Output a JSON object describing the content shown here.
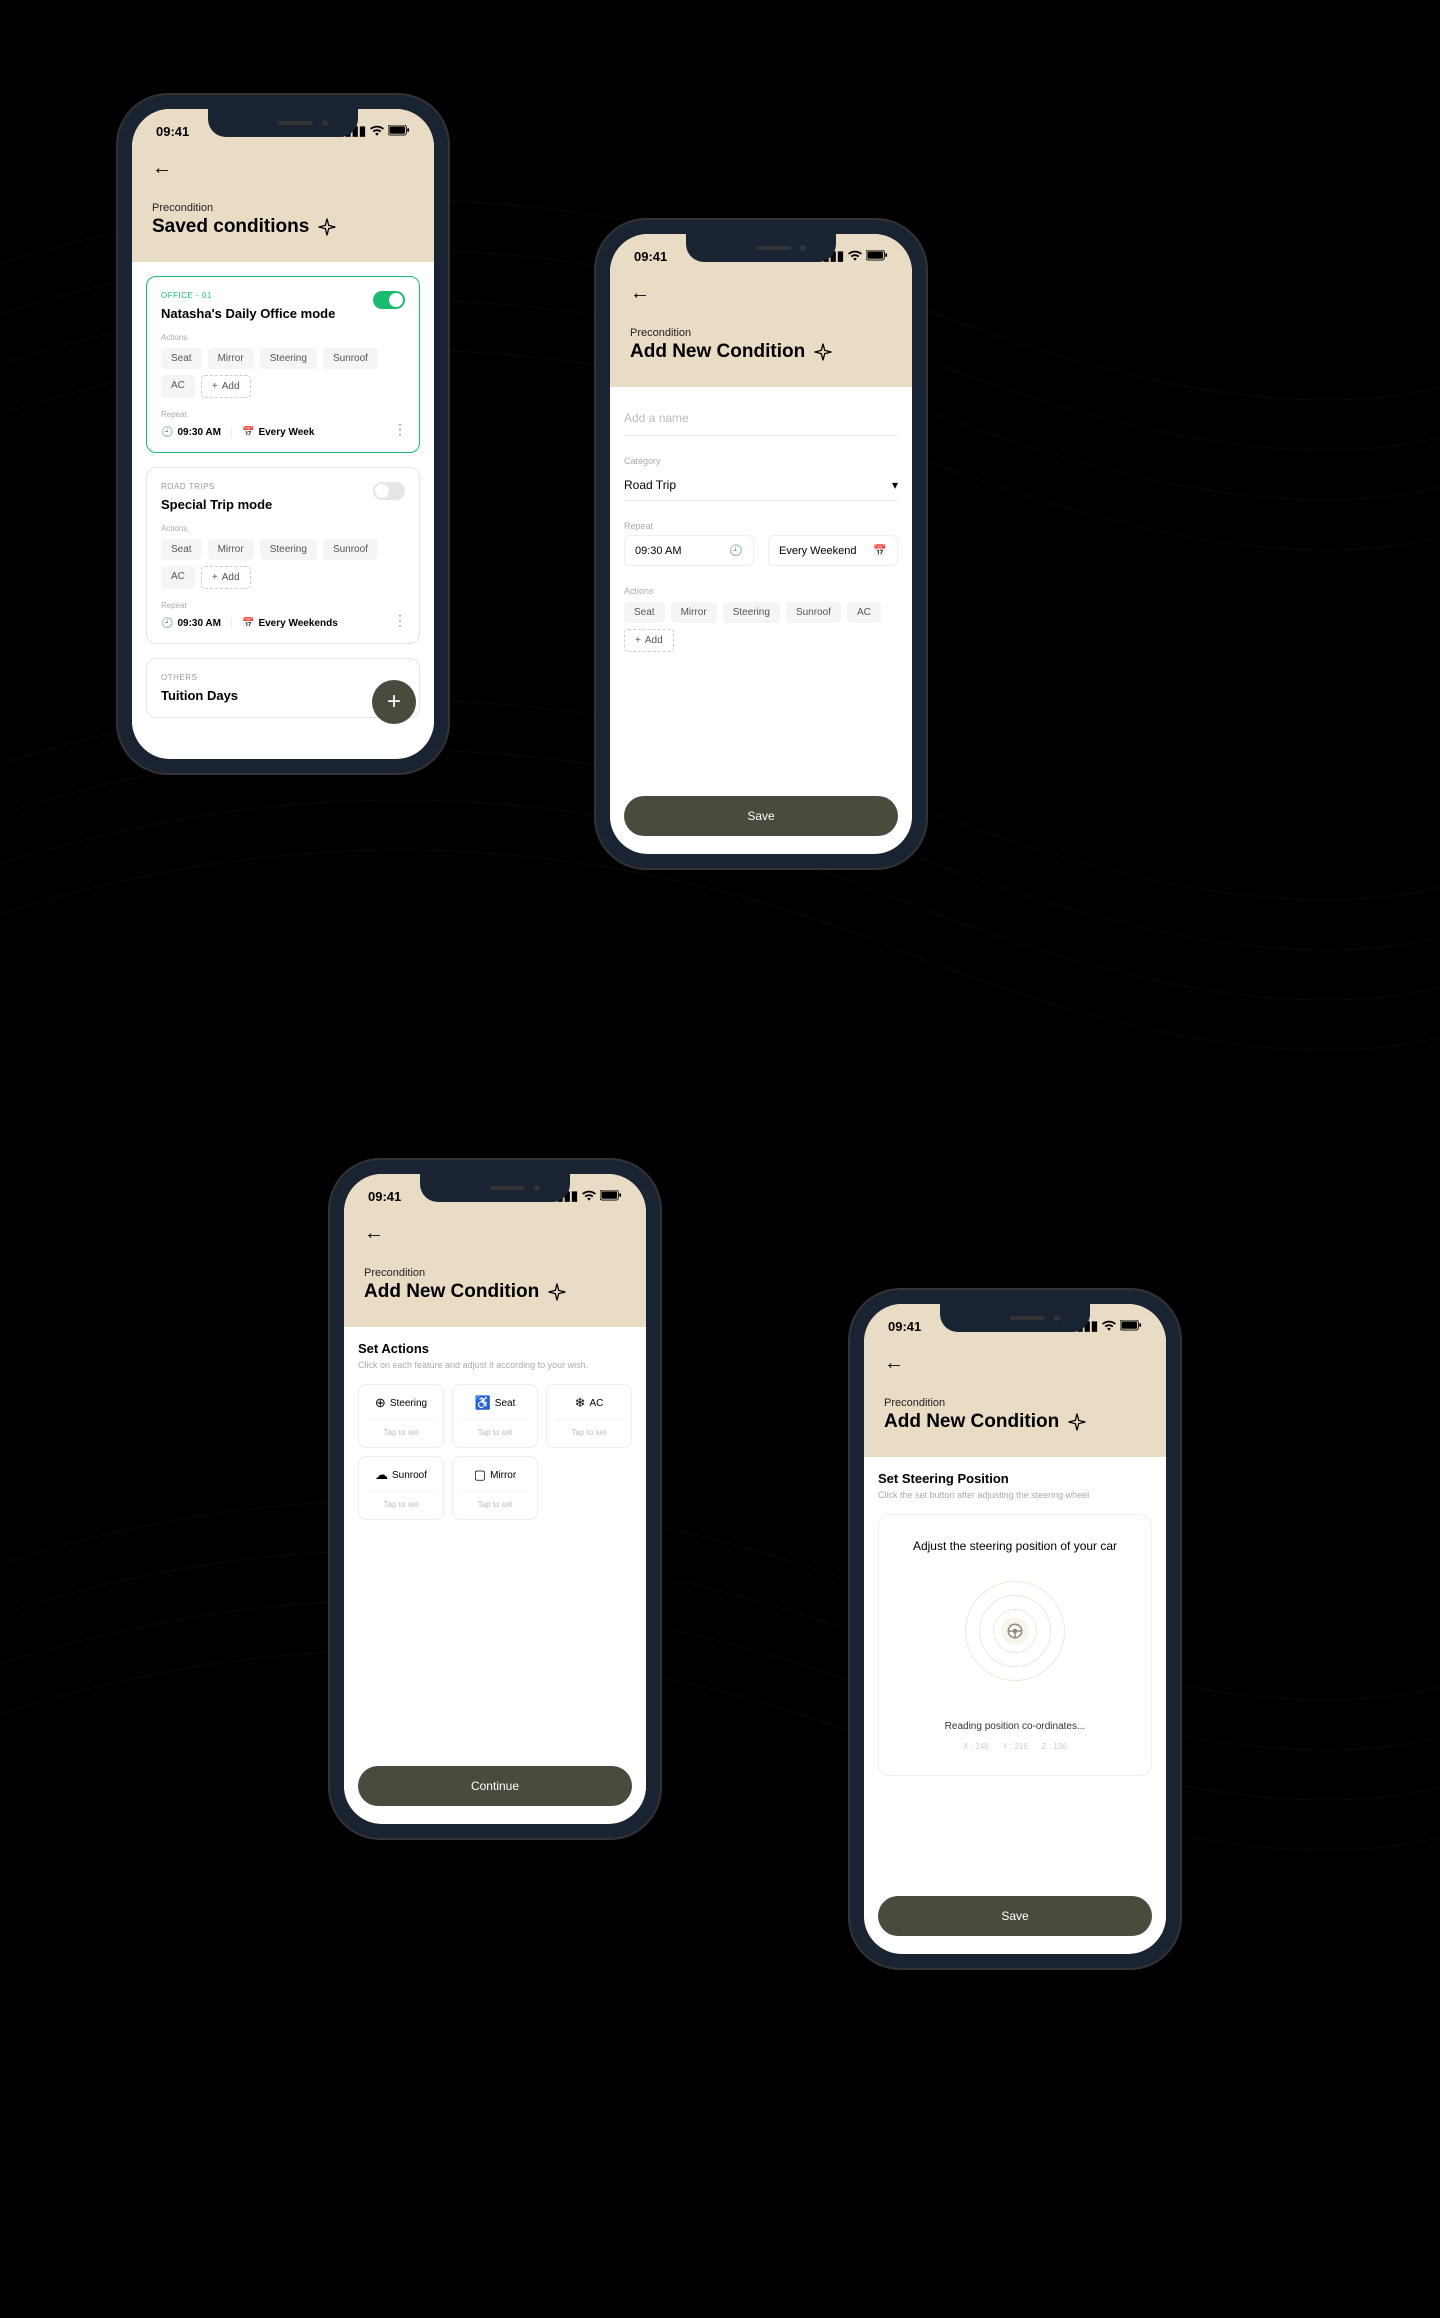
{
  "status": {
    "time": "09:41"
  },
  "screen1": {
    "breadcrumb": "Precondition",
    "title": "Saved conditions",
    "cards": [
      {
        "tag": "OFFICE - 01",
        "title": "Natasha's Daily Office mode",
        "actions_label": "Actions",
        "actions": [
          "Seat",
          "Mirror",
          "Steering",
          "Sunroof",
          "AC"
        ],
        "add_label": "Add",
        "repeat_label": "Repeat",
        "time": "09:30 AM",
        "freq": "Every Week",
        "active": true
      },
      {
        "tag": "ROAD TRIPS",
        "title": "Special Trip mode",
        "actions_label": "Actions",
        "actions": [
          "Seat",
          "Mirror",
          "Steering",
          "Sunroof",
          "AC"
        ],
        "add_label": "Add",
        "repeat_label": "Repeat",
        "time": "09:30 AM",
        "freq": "Every Weekends",
        "active": false
      },
      {
        "tag": "OTHERS",
        "title": "Tuition Days"
      }
    ]
  },
  "screen2": {
    "breadcrumb": "Precondition",
    "title": "Add New Condition",
    "name_placeholder": "Add a name",
    "category_label": "Category",
    "category_value": "Road Trip",
    "repeat_label": "Repeat",
    "time_value": "09:30 AM",
    "freq_value": "Every Weekend",
    "actions_label": "Actions",
    "actions": [
      "Seat",
      "Mirror",
      "Steering",
      "Sunroof",
      "AC"
    ],
    "add_label": "Add",
    "save_label": "Save"
  },
  "screen3": {
    "breadcrumb": "Precondition",
    "title": "Add New Condition",
    "heading": "Set Actions",
    "sub": "Click on each feature and adjust it according to your wish.",
    "items": [
      {
        "name": "Steering",
        "tap": "Tap to set"
      },
      {
        "name": "Seat",
        "tap": "Tap to set"
      },
      {
        "name": "AC",
        "tap": "Tap to set"
      },
      {
        "name": "Sunroof",
        "tap": "Tap to set"
      },
      {
        "name": "Mirror",
        "tap": "Tap to set"
      }
    ],
    "continue_label": "Continue"
  },
  "screen4": {
    "breadcrumb": "Precondition",
    "title": "Add New Condition",
    "heading": "Set Steering Position",
    "sub": "Click the set button after adjusting the steering wheel",
    "adjust_text": "Adjust the steering position of your car",
    "reading": "Reading position co-ordinates...",
    "coords": {
      "x": "X : 248",
      "y": "Y : 216",
      "z": "Z : 136"
    },
    "save_label": "Save"
  }
}
